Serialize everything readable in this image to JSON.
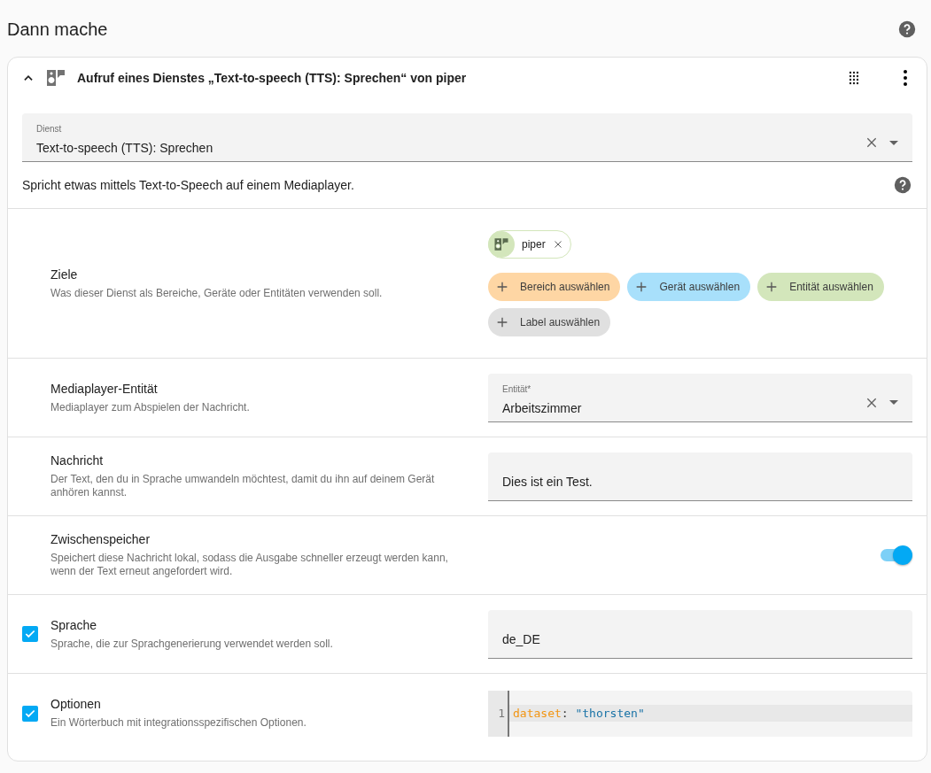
{
  "section": {
    "title": "Dann mache"
  },
  "action": {
    "title": "Aufruf eines Dienstes „Text-to-speech (TTS): Sprechen“ von piper",
    "expanded": true,
    "service_field": {
      "label": "Dienst",
      "value": "Text-to-speech (TTS): Sprechen"
    },
    "description": "Spricht etwas mittels Text-to-Speech auf einem Mediaplayer.",
    "fields": [
      {
        "kind": "targets",
        "name": "Ziele",
        "description": "Was dieser Dienst als Bereiche, Geräte oder Entitäten verwenden soll.",
        "chips": [
          {
            "label": "piper"
          }
        ],
        "add_buttons": [
          {
            "label": "Bereich auswählen",
            "color": "#fed6a4"
          },
          {
            "label": "Gerät auswählen",
            "color": "#a8e0fb"
          },
          {
            "label": "Entität auswählen",
            "color": "#d3e6bb"
          },
          {
            "label": "Label auswählen",
            "color": "#e0e0e0"
          }
        ]
      },
      {
        "kind": "select",
        "name": "Mediaplayer-Entität",
        "description": "Mediaplayer zum Abspielen der Nachricht.",
        "field_label": "Entität*",
        "value": "Arbeitszimmer"
      },
      {
        "kind": "text",
        "name": "Nachricht",
        "description": "Der Text, den du in Sprache umwandeln möchtest, damit du ihn auf deinem Gerät anhören kannst.",
        "value": "Dies ist ein Test."
      },
      {
        "kind": "toggle",
        "name": "Zwischenspeicher",
        "description": "Speichert diese Nachricht lokal, sodass die Ausgabe schneller erzeugt werden kann, wenn der Text erneut angefordert wird.",
        "on": true
      },
      {
        "kind": "text",
        "name": "Sprache",
        "description": "Sprache, die zur Sprachgenerierung verwendet werden soll.",
        "checked": true,
        "value": "de_DE"
      },
      {
        "kind": "code",
        "name": "Optionen",
        "description": "Ein Wörterbuch mit integrationsspezifischen Optionen.",
        "checked": true,
        "lines": [
          {
            "number": "1",
            "key": "dataset",
            "separator": ":",
            "value": "\"thorsten\""
          }
        ]
      }
    ]
  }
}
